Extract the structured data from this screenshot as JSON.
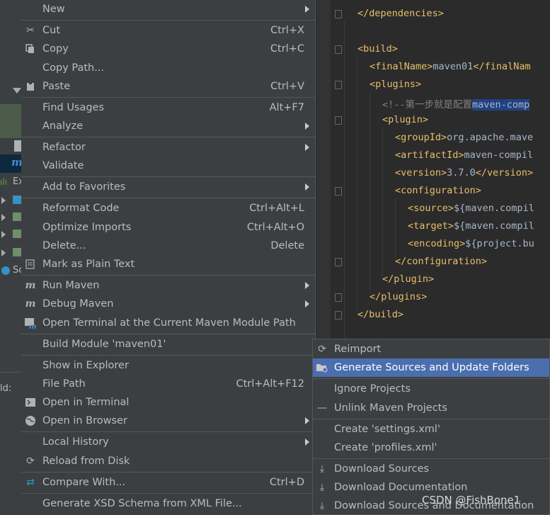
{
  "menu": {
    "items": [
      {
        "label": "New",
        "shortcut": "",
        "icon": "",
        "submenu": true
      },
      {
        "label": "Cut",
        "shortcut": "Ctrl+X",
        "icon": "scissors-icon",
        "submenu": false
      },
      {
        "label": "Copy",
        "shortcut": "Ctrl+C",
        "icon": "copy-icon",
        "submenu": false
      },
      {
        "label": "Copy Path...",
        "shortcut": "",
        "icon": "",
        "submenu": false
      },
      {
        "label": "Paste",
        "shortcut": "Ctrl+V",
        "icon": "paste-icon",
        "submenu": false
      },
      {
        "label": "Find Usages",
        "shortcut": "Alt+F7",
        "icon": "",
        "submenu": false
      },
      {
        "label": "Analyze",
        "shortcut": "",
        "icon": "",
        "submenu": true
      },
      {
        "label": "Refactor",
        "shortcut": "",
        "icon": "",
        "submenu": true
      },
      {
        "label": "Validate",
        "shortcut": "",
        "icon": "",
        "submenu": false
      },
      {
        "label": "Add to Favorites",
        "shortcut": "",
        "icon": "",
        "submenu": true
      },
      {
        "label": "Reformat Code",
        "shortcut": "Ctrl+Alt+L",
        "icon": "",
        "submenu": false
      },
      {
        "label": "Optimize Imports",
        "shortcut": "Ctrl+Alt+O",
        "icon": "",
        "submenu": false
      },
      {
        "label": "Delete...",
        "shortcut": "Delete",
        "icon": "",
        "submenu": false
      },
      {
        "label": "Mark as Plain Text",
        "shortcut": "",
        "icon": "plain-text-icon",
        "submenu": false
      },
      {
        "label": "Run Maven",
        "shortcut": "",
        "icon": "maven-run-icon",
        "submenu": true
      },
      {
        "label": "Debug Maven",
        "shortcut": "",
        "icon": "maven-debug-icon",
        "submenu": true
      },
      {
        "label": "Open Terminal at the Current Maven Module Path",
        "shortcut": "",
        "icon": "maven-terminal-icon",
        "submenu": false
      },
      {
        "label": "Build Module 'maven01'",
        "shortcut": "",
        "icon": "",
        "submenu": false
      },
      {
        "label": "Show in Explorer",
        "shortcut": "",
        "icon": "",
        "submenu": false
      },
      {
        "label": "File Path",
        "shortcut": "Ctrl+Alt+F12",
        "icon": "",
        "submenu": false
      },
      {
        "label": "Open in Terminal",
        "shortcut": "",
        "icon": "terminal-icon",
        "submenu": false
      },
      {
        "label": "Open in Browser",
        "shortcut": "",
        "icon": "globe-icon",
        "submenu": true
      },
      {
        "label": "Local History",
        "shortcut": "",
        "icon": "",
        "submenu": true
      },
      {
        "label": "Reload from Disk",
        "shortcut": "",
        "icon": "reload-icon",
        "submenu": false
      },
      {
        "label": "Compare With...",
        "shortcut": "Ctrl+D",
        "icon": "compare-icon",
        "submenu": false
      },
      {
        "label": "Generate XSD Schema from XML File...",
        "shortcut": "",
        "icon": "",
        "submenu": false
      }
    ]
  },
  "maven_submenu": {
    "items": [
      {
        "label": "Reimport",
        "icon": "reimport-icon"
      },
      {
        "label": "Generate Sources and Update Folders",
        "icon": "folder-gear-icon",
        "active": true
      },
      {
        "label": "Ignore Projects",
        "icon": ""
      },
      {
        "label": "Unlink Maven Projects",
        "icon": "minus-icon"
      },
      {
        "label": "Create 'settings.xml'",
        "icon": ""
      },
      {
        "label": "Create 'profiles.xml'",
        "icon": ""
      },
      {
        "label": "Download Sources",
        "icon": "download-icon"
      },
      {
        "label": "Download Documentation",
        "icon": "download-icon"
      },
      {
        "label": "Download Sources and Documentation",
        "icon": "download-icon"
      }
    ]
  },
  "editor": {
    "lines": [
      "</dependencies>",
      "",
      "<build>",
      "<finalName>maven01</finalNam",
      "<plugins>",
      "<!--第一步就是配置maven-comp",
      "<plugin>",
      "<groupId>org.apache.mave",
      "<artifactId>maven-compil",
      "<version>3.7.0</version>",
      "<configuration>",
      "<source>${maven.compil",
      "<target>${maven.compil",
      "<encoding>${project.bu",
      "</configuration>",
      "</plugin>",
      "</plugins>",
      "</build>"
    ]
  },
  "left_panel": {
    "labels": [
      "Ex",
      "Sc",
      "ld:"
    ]
  },
  "watermark": "CSDN @FishBone1"
}
